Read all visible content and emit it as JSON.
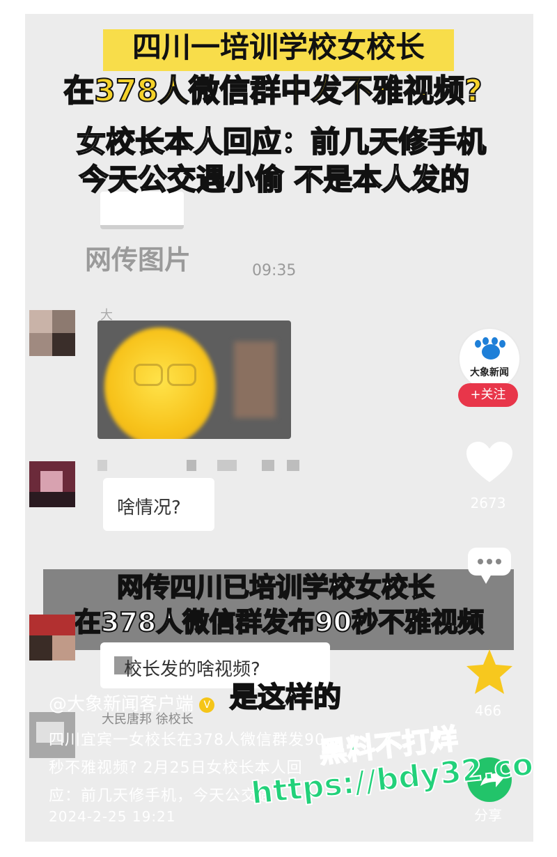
{
  "header": {
    "title_line1": "四川一培训学校女校长",
    "title_line2": "在378人微信群中发不雅视频?",
    "subtitle_line1": "女校长本人回应：前几天修手机",
    "subtitle_line2": "今天公交遇小偷 不是本人发的"
  },
  "chat": {
    "image_label": "网传图片",
    "timestamp": "09:35",
    "sender1_partial": "大",
    "message1": "啥情况?",
    "message2": "校长发的啥视频?",
    "sender3": "大民唐邦 徐校长"
  },
  "banner": {
    "line1": "网传四川已培训学校女校长",
    "line2": "在378人微信群发布90秒不雅视频"
  },
  "subtitle_caption": "是这样的",
  "sidebar": {
    "account_logo_text": "大象新闻",
    "follow_label": "+关注",
    "like_count": "2673",
    "share_label": "分享",
    "favorite_count": "466"
  },
  "post": {
    "author": "@大象新闻客户端",
    "verified_badge": "V",
    "desc_line1": "四川宜宾一女校长在378人微信群发90",
    "desc_line2": "秒不雅视频? 2月25日女校长本人回",
    "desc_line3": "应：前几天修手机，今天公交遇",
    "date": "2024-2-25 19:21"
  },
  "watermark": {
    "line1": "黑料不打烊",
    "line2": "https://bdy32.co"
  },
  "colors": {
    "title_yellow": "#f5d22a",
    "follow_red": "#e8364a",
    "logo_blue": "#1e7fd8",
    "watermark_green": "#22d17a",
    "favorite_yellow": "#f7c81e"
  }
}
